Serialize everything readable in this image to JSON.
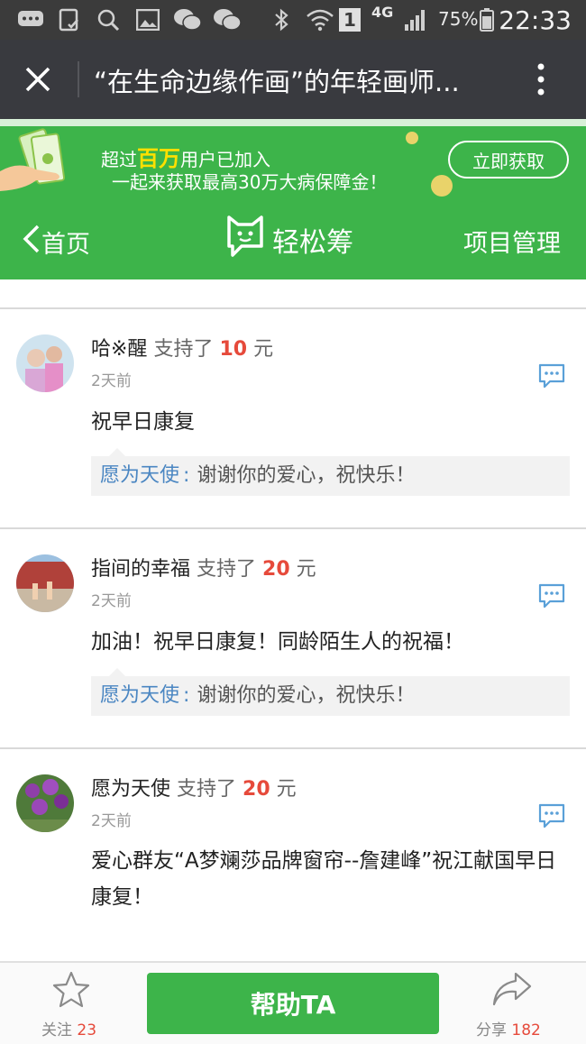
{
  "status_bar": {
    "battery": "75%",
    "time": "22:33",
    "network": "4G",
    "sim": "1",
    "icons": [
      "chat-bubble-icon",
      "clipboard-check-icon",
      "search-icon",
      "image-icon",
      "wechat-icon",
      "wechat-icon",
      "bluetooth-icon",
      "wifi-icon",
      "signal-icon",
      "battery-icon"
    ]
  },
  "title_bar": {
    "title": "“在生命边缘作画”的年轻画师...",
    "close_icon": "close-icon",
    "more_icon": "more-vertical-icon"
  },
  "banner": {
    "line1_prefix": "超过",
    "line1_highlight": "百万",
    "line1_suffix": "用户已加入",
    "line2": "一起来获取最高30万大病保障金！",
    "button": "立即获取",
    "colors": {
      "bg": "#3db44a",
      "highlight": "#ffe000"
    }
  },
  "nav": {
    "back_label": "首页",
    "logo_text": "轻松筹",
    "manage_label": "项目管理"
  },
  "comments": [
    {
      "name": "哈※醒",
      "action": "支持了",
      "amount": "10",
      "unit": "元",
      "time": "2天前",
      "text": "祝早日康复",
      "reply_name": "愿为天使",
      "reply_sep": ":",
      "reply_text": "谢谢你的爱心，祝快乐！"
    },
    {
      "name": "指间的幸福",
      "action": "支持了",
      "amount": "20",
      "unit": "元",
      "time": "2天前",
      "text": "加油！祝早日康复！同龄陌生人的祝福！",
      "reply_name": "愿为天使",
      "reply_sep": ":",
      "reply_text": "谢谢你的爱心，祝快乐！"
    },
    {
      "name": "愿为天使",
      "action": "支持了",
      "amount": "20",
      "unit": "元",
      "time": "2天前",
      "text": "爱心群友“A梦斓莎品牌窗帘--詹建峰”祝江献国早日康复！"
    }
  ],
  "bottom_bar": {
    "follow_label": "关注",
    "follow_count": "23",
    "help_button": "帮助TA",
    "share_label": "分享",
    "share_count": "182"
  },
  "colors": {
    "accent": "#3db44a",
    "amount": "#e64a3b",
    "reply_name": "#4a86c2"
  }
}
